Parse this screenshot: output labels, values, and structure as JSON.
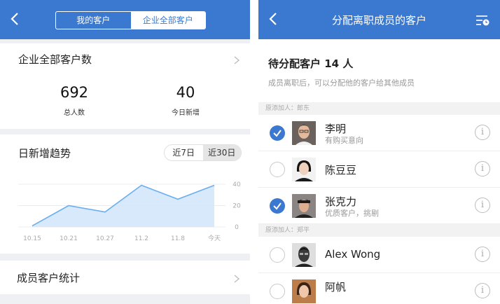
{
  "left": {
    "tabs": {
      "mine": "我的客户",
      "all": "企业全部客户"
    },
    "total_section": {
      "title": "企业全部客户数",
      "total_value": "692",
      "total_label": "总人数",
      "new_value": "40",
      "new_label": "今日新增"
    },
    "trend": {
      "title": "日新增趋势",
      "range_7": "近7日",
      "range_30": "近30日"
    },
    "member_stats": {
      "title": "成员客户统计"
    }
  },
  "right": {
    "title": "分配离职成员的客户",
    "pending": "待分配客户 14 人",
    "hint": "成员离职后，可以分配他的客户给其他成员",
    "groups": [
      {
        "label": "原添加人：郎东",
        "items": [
          {
            "name": "李明",
            "tag": "有购买意向",
            "checked": true,
            "avatar": "man-glasses"
          },
          {
            "name": "陈豆豆",
            "tag": "",
            "checked": false,
            "avatar": "woman"
          },
          {
            "name": "张克力",
            "tag": "优质客户，挑剔",
            "checked": true,
            "avatar": "man-cap"
          }
        ]
      },
      {
        "label": "原添加人：郑平",
        "items": [
          {
            "name": "Alex Wong",
            "tag": "",
            "checked": false,
            "avatar": "man-dark"
          },
          {
            "name": "阿帆",
            "tag": "",
            "checked": false,
            "avatar": "woman-2"
          }
        ]
      }
    ]
  },
  "chart_data": {
    "type": "area",
    "x": [
      "10.15",
      "10.21",
      "10.27",
      "11.2",
      "11.8",
      "今天"
    ],
    "series": [
      {
        "values": [
          1,
          20,
          14,
          39,
          26,
          39
        ]
      }
    ],
    "ylim": [
      0,
      40
    ],
    "yticks": [
      "0",
      "20",
      "40"
    ],
    "grid": true,
    "colors": {
      "line": "#6aaeef",
      "fill": "#d3e7fb"
    }
  }
}
